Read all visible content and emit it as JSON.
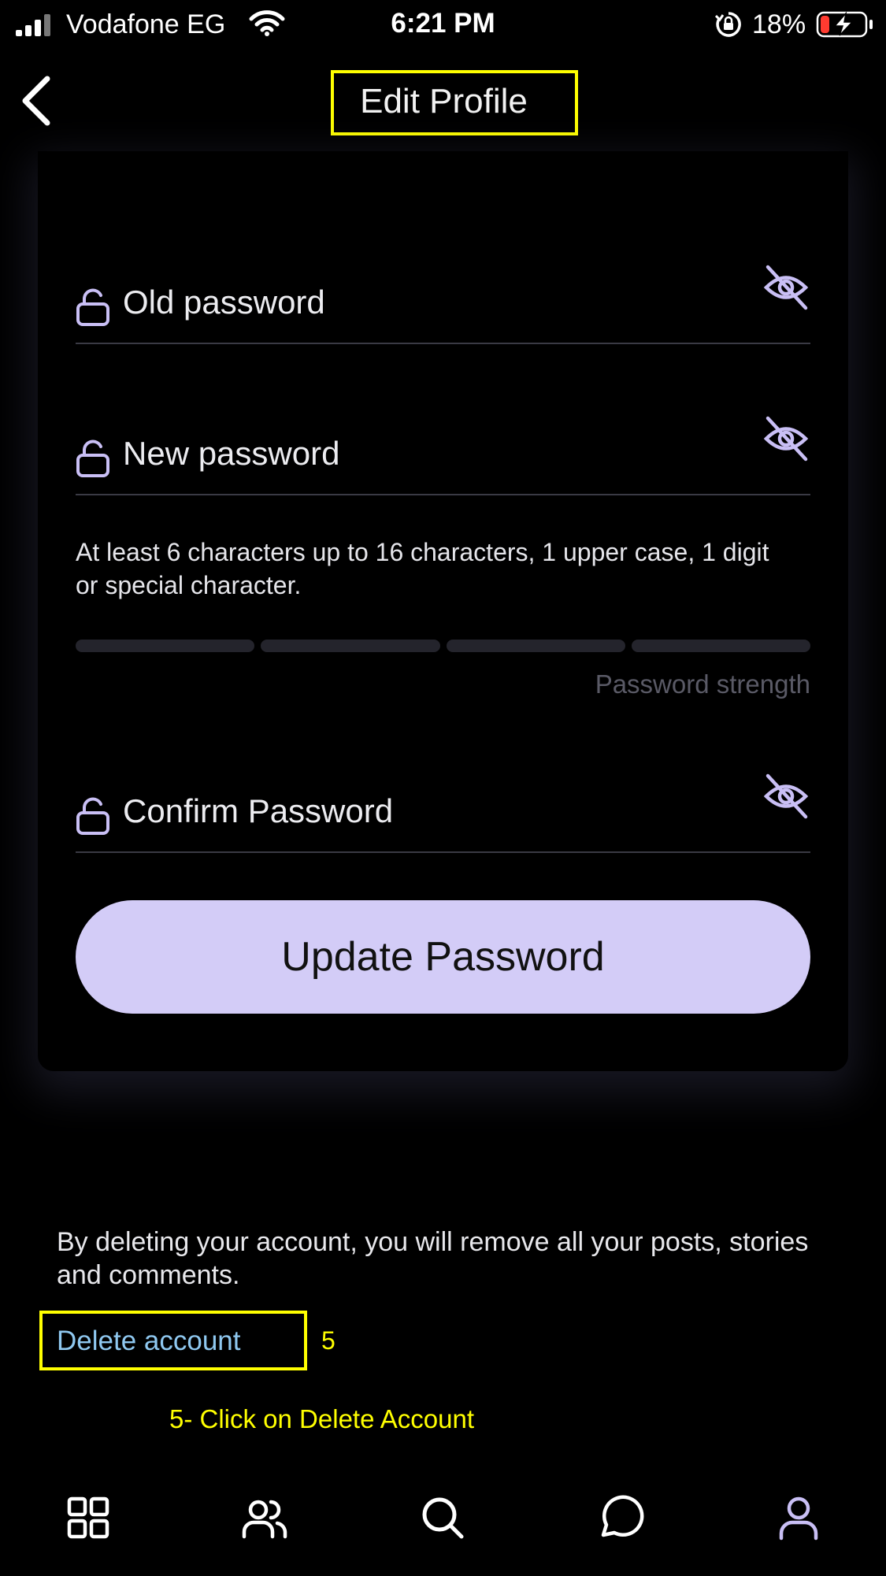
{
  "status_bar": {
    "carrier": "Vodafone EG",
    "time": "6:21 PM",
    "battery_percent": "18%",
    "battery_level": 0.18
  },
  "header": {
    "title": "Edit Profile"
  },
  "form": {
    "old_password_label": "Old password",
    "new_password_label": "New password",
    "hint": "At least 6 characters up to 16 characters, 1 upper case, 1 digit or special character.",
    "strength_label": "Password strength",
    "strength_segments_filled": 0,
    "confirm_password_label": "Confirm Password",
    "update_button_label": "Update Password"
  },
  "delete_section": {
    "note": "By deleting your account, you will remove all your posts, stories and comments.",
    "link_label": "Delete account",
    "step_number": "5",
    "step_caption": "5- Click on Delete Account"
  },
  "tab_bar": {
    "icons": [
      "grid-icon",
      "users-icon",
      "search-icon",
      "chat-icon",
      "profile-icon"
    ],
    "active": "profile-icon"
  },
  "colors": {
    "accent": "#d3ccf7",
    "icon_purple": "#c9bff5",
    "link": "#8fc8f0",
    "annotation": "#ffff00"
  }
}
